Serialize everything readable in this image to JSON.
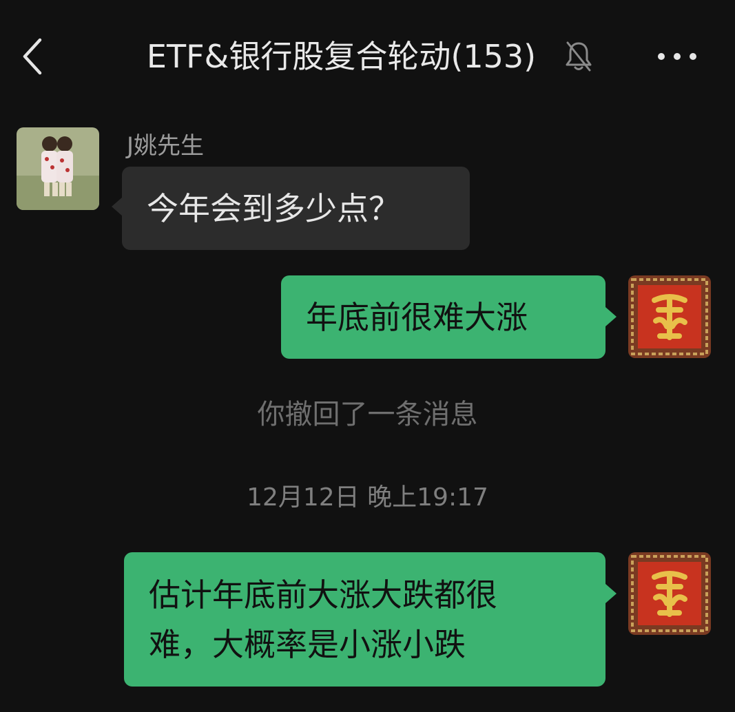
{
  "header": {
    "title": "ETF&银行股复合轮动(153)",
    "back_icon": "chevron-left-icon",
    "mute_icon": "bell-off-icon",
    "more_icon": "more-dots-icon"
  },
  "messages": [
    {
      "sender": "J姚先生",
      "text": "今年会到多少点？",
      "direction": "incoming"
    },
    {
      "text": "年底前很难大涨",
      "direction": "outgoing"
    },
    {
      "text": "估计年底前大涨大跌都很难，大概率是小涨小跌",
      "line1": "估计年底前大涨大跌都很",
      "line2": "难，大概率是小涨小跌",
      "direction": "outgoing"
    }
  ],
  "system": {
    "recall_notice": "你撤回了一条消息",
    "timestamp": "12月12日 晚上19:17"
  },
  "colors": {
    "background": "#111111",
    "incoming_bubble": "#2c2c2c",
    "outgoing_bubble": "#3cb371"
  }
}
